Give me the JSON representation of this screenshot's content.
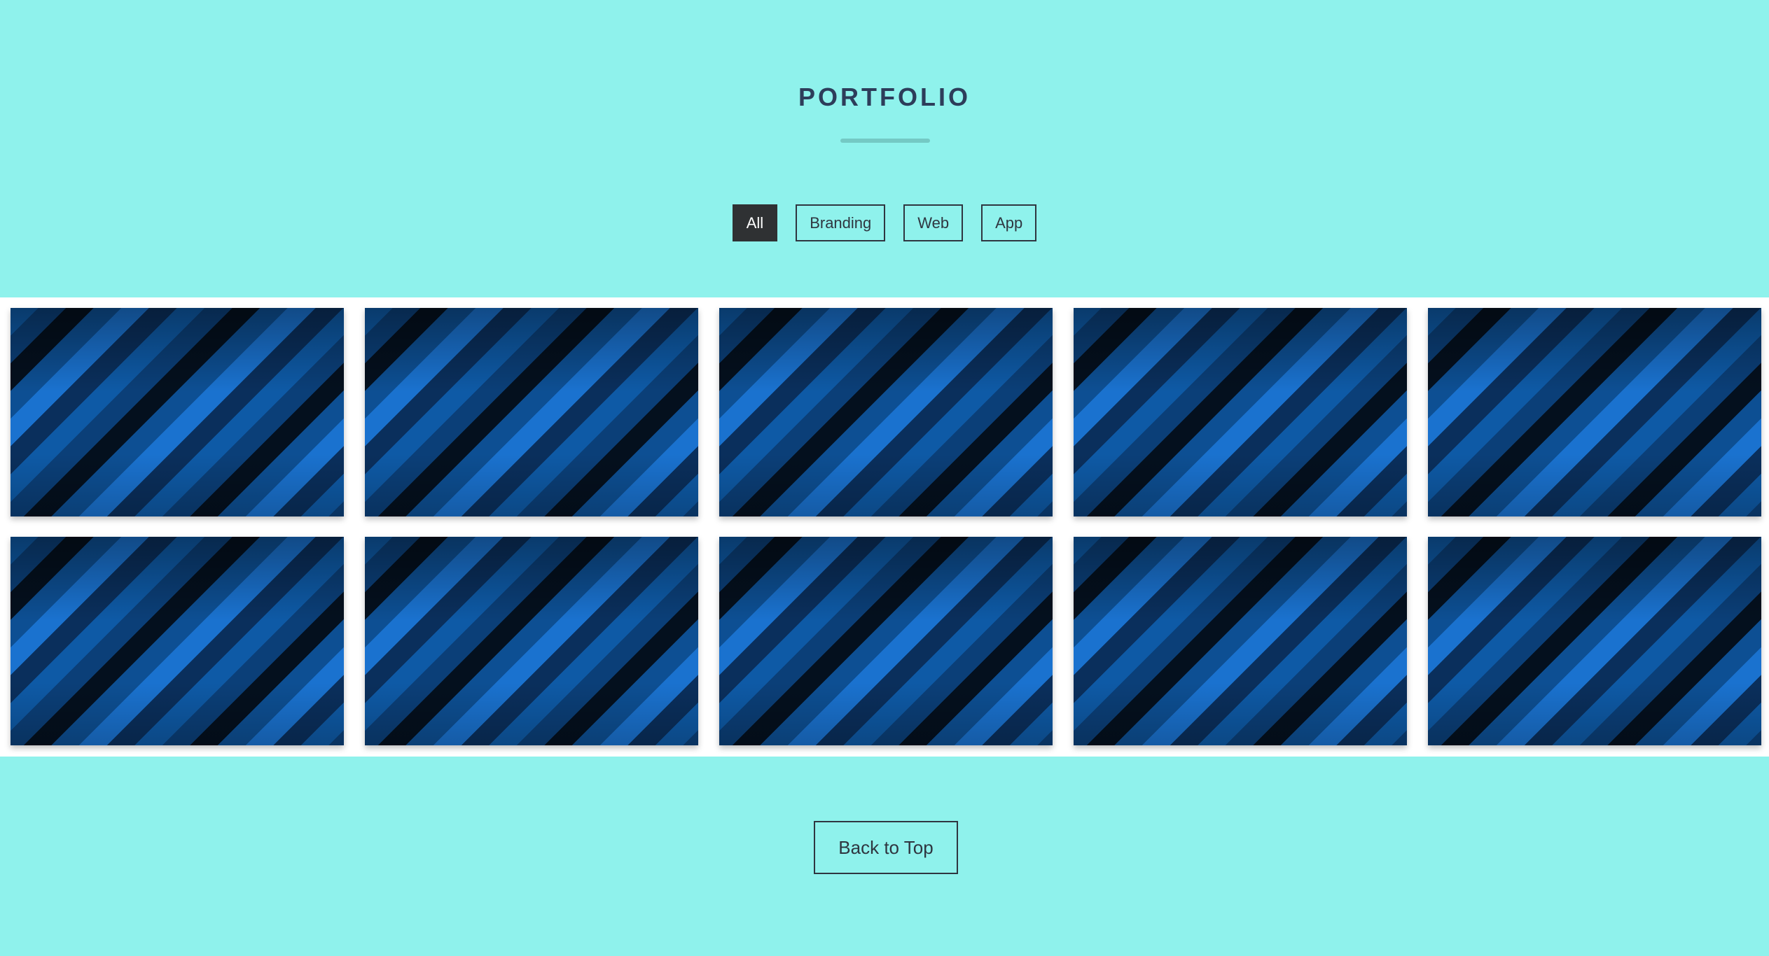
{
  "section": {
    "title": "PORTFOLIO"
  },
  "filters": [
    {
      "label": "All",
      "active": true
    },
    {
      "label": "Branding",
      "active": false
    },
    {
      "label": "Web",
      "active": false
    },
    {
      "label": "App",
      "active": false
    }
  ],
  "gallery": {
    "item_count": 10
  },
  "footer": {
    "back_to_top_label": "Back to Top"
  },
  "colors": {
    "background": "#8ff2ec",
    "title": "#2d3d5a",
    "active_filter": "#2f3133",
    "tile_accent": "#1a72cf"
  }
}
